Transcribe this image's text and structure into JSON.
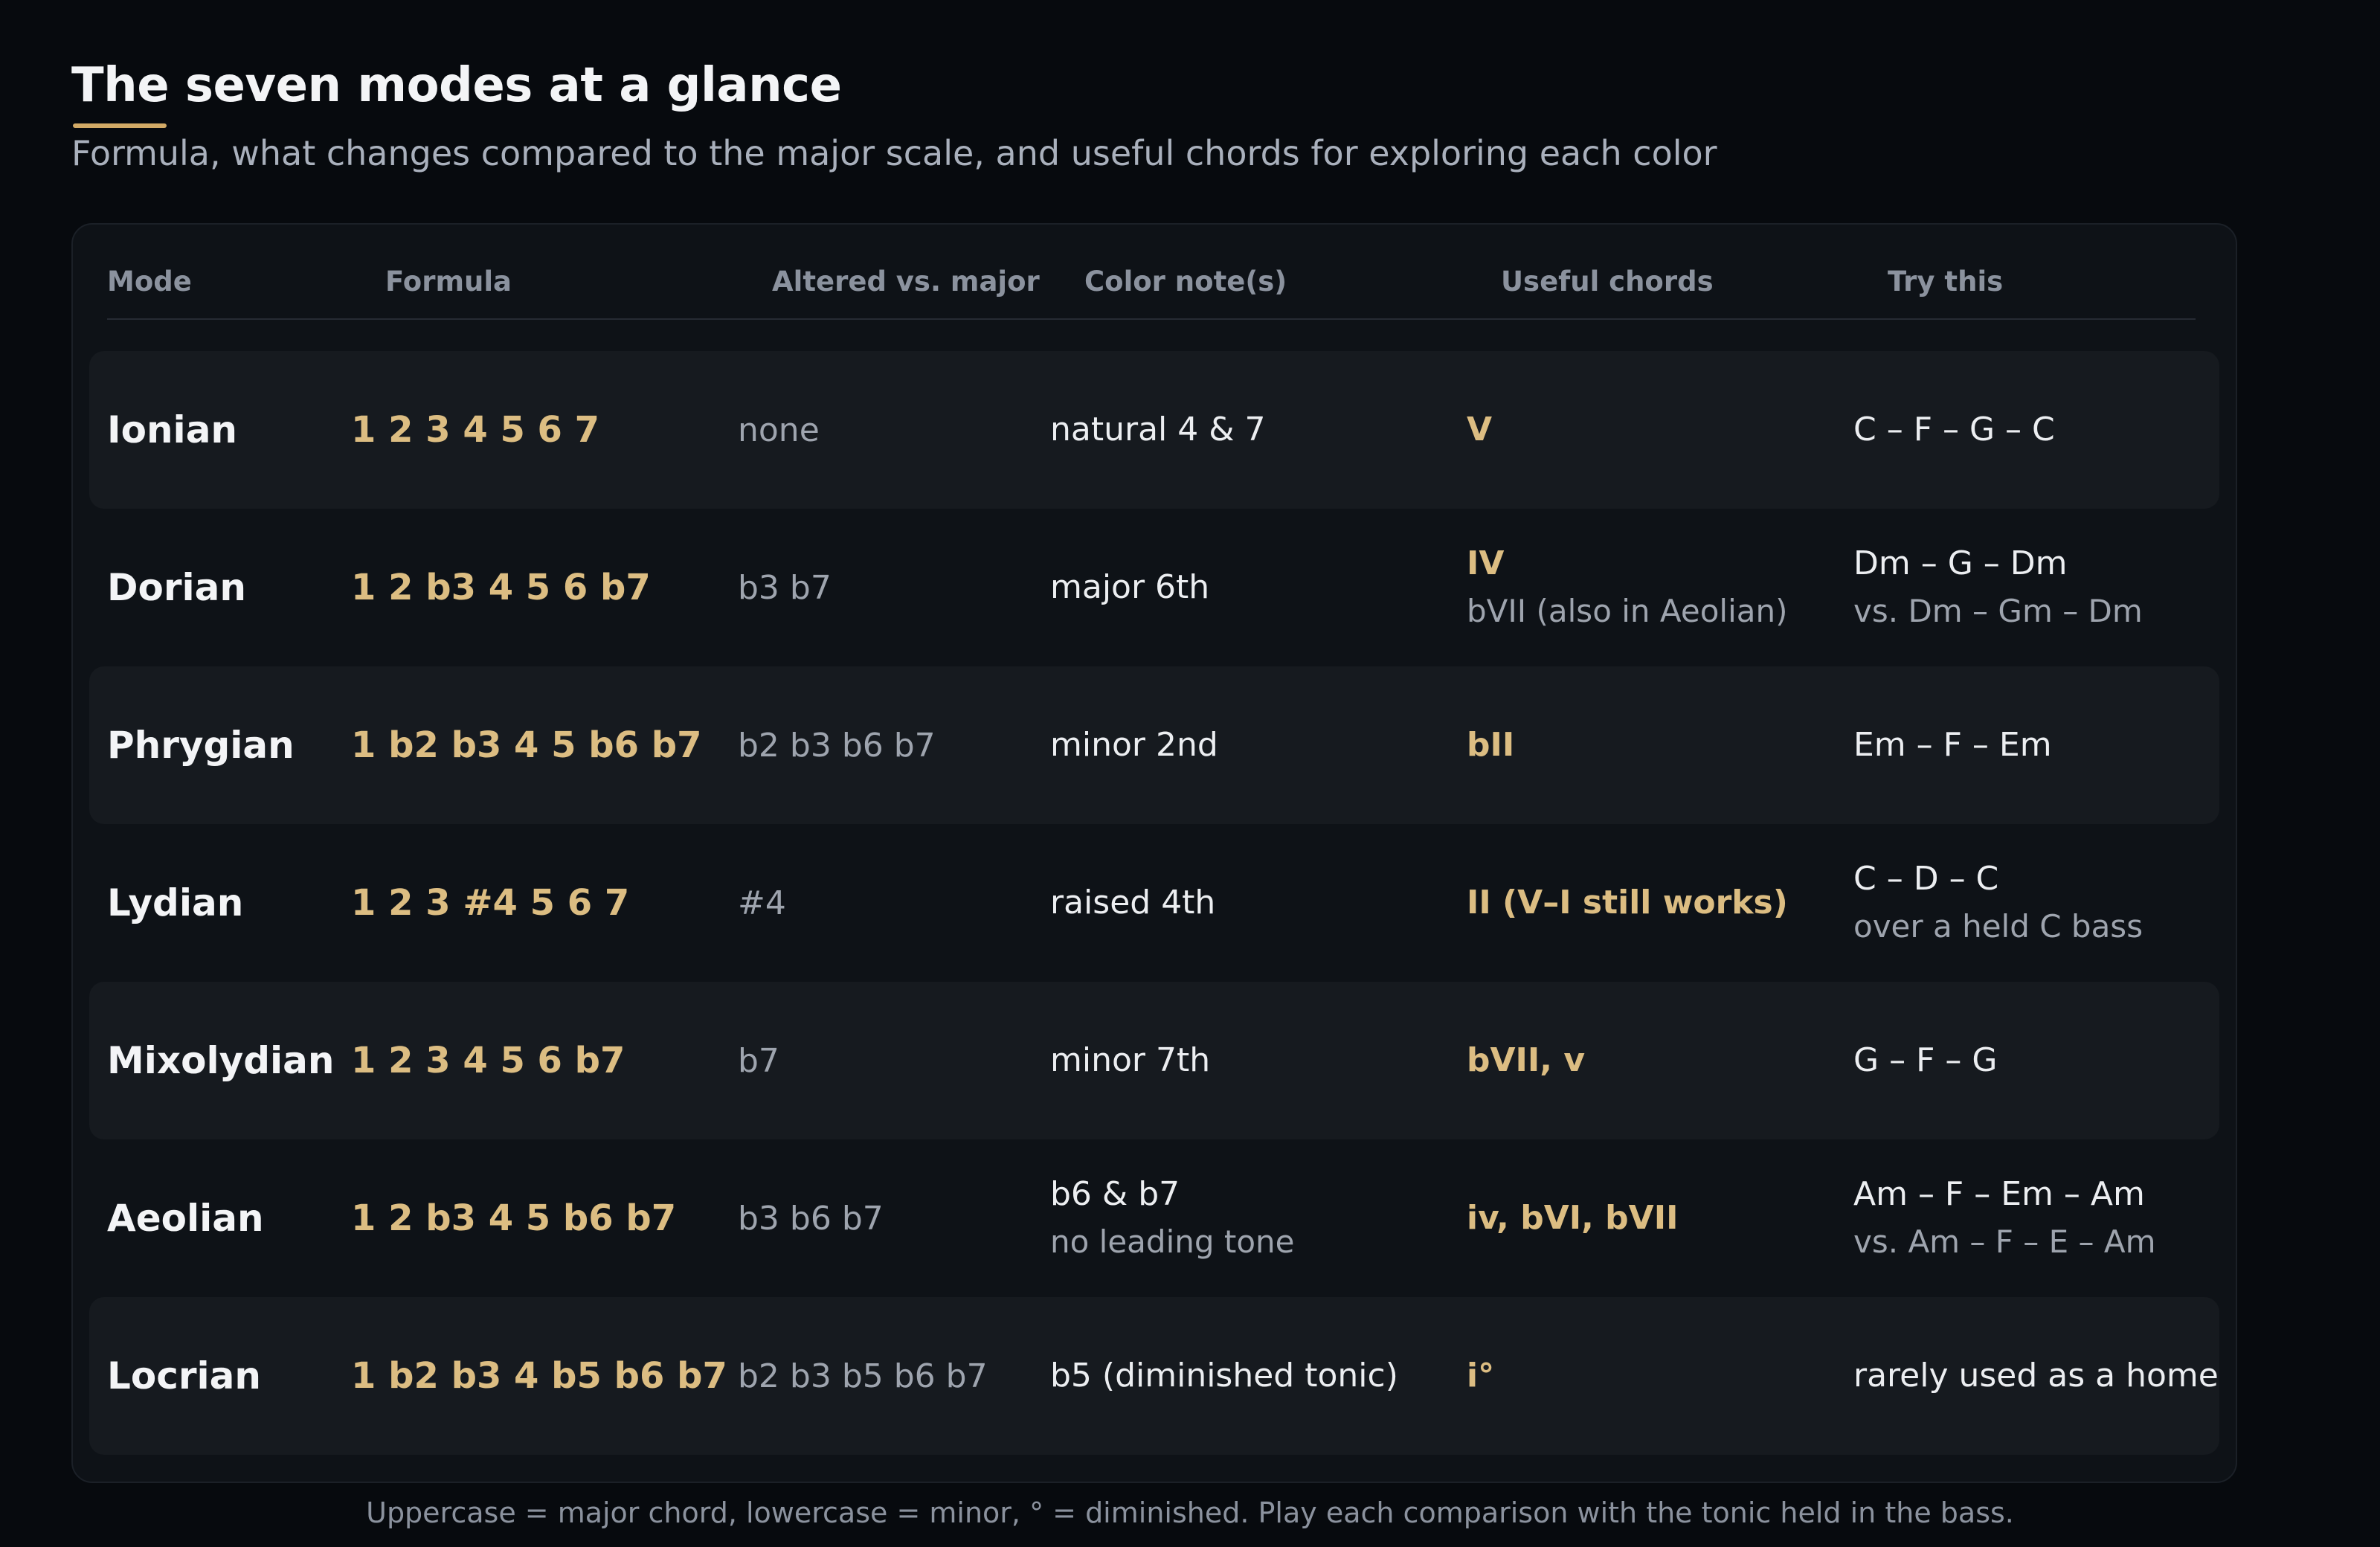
{
  "title": "The seven modes at a glance",
  "subtitle": "Formula, what changes compared to the major scale, and useful chords for exploring each color",
  "accent_color": "#d2aa66",
  "columns": [
    "Mode",
    "Formula",
    "Altered vs. major",
    "Color note(s)",
    "Useful chords",
    "Try this"
  ],
  "rows": [
    {
      "mode": "Ionian",
      "formula": "1 2 3 4 5 6 7",
      "altered": "none",
      "color": "natural 4 & 7",
      "color_sub": "",
      "chords": "V",
      "chords_sub": "",
      "try": "C – F – G – C",
      "try_sub": ""
    },
    {
      "mode": "Dorian",
      "formula": "1 2 b3 4 5 6 b7",
      "altered": "b3 b7",
      "color": "major 6th",
      "color_sub": "",
      "chords": "IV",
      "chords_sub": "bVII (also in Aeolian)",
      "try": "Dm – G – Dm",
      "try_sub": "vs. Dm – Gm – Dm"
    },
    {
      "mode": "Phrygian",
      "formula": "1 b2 b3 4 5 b6 b7",
      "altered": "b2 b3 b6 b7",
      "color": "minor 2nd",
      "color_sub": "",
      "chords": "bII",
      "chords_sub": "",
      "try": "Em – F – Em",
      "try_sub": ""
    },
    {
      "mode": "Lydian",
      "formula": "1 2 3 #4 5 6 7",
      "altered": "#4",
      "color": "raised 4th",
      "color_sub": "",
      "chords": "II (V–I still works)",
      "chords_sub": "",
      "try": "C – D – C",
      "try_sub": "over a held C bass"
    },
    {
      "mode": "Mixolydian",
      "formula": "1 2 3 4 5 6 b7",
      "altered": "b7",
      "color": "minor 7th",
      "color_sub": "",
      "chords": "bVII, v",
      "chords_sub": "",
      "try": "G – F – G",
      "try_sub": ""
    },
    {
      "mode": "Aeolian",
      "formula": "1 2 b3 4 5 b6 b7",
      "altered": "b3 b6 b7",
      "color": "b6 & b7",
      "color_sub": "no leading tone",
      "chords": "iv, bVI, bVII",
      "chords_sub": "",
      "try": "Am – F – Em – Am",
      "try_sub": "vs. Am – F – E – Am"
    },
    {
      "mode": "Locrian",
      "formula": "1 b2 b3 4 b5 b6 b7",
      "altered": "b2 b3 b5 b6 b7",
      "color": "b5 (diminished tonic)",
      "color_sub": "",
      "chords": "i°",
      "chords_sub": "",
      "try": "rarely used as a home",
      "try_sub": ""
    }
  ],
  "footnote": "Uppercase = major chord, lowercase = minor, ° = diminished. Play each comparison with the tonic held in the bass."
}
